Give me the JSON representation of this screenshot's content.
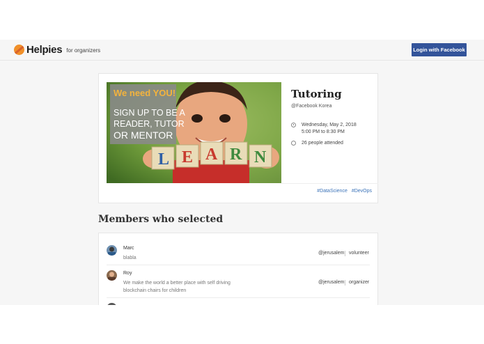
{
  "header": {
    "brand": "Helpies",
    "brand_sub": "for organizers",
    "login_label": "Login with Facebook"
  },
  "event": {
    "image_lines": [
      "We need YOU!",
      "SIGN UP TO BE A",
      "READER, TUTOR",
      "OR MENTOR"
    ],
    "blocks": [
      "L",
      "E",
      "A",
      "R",
      "N"
    ],
    "title": "Tutoring",
    "organizer": "@Facebook Korea",
    "date": "Wednesday, May 2, 2018",
    "time": "5:00 PM to 8:30 PM",
    "attended": "26 people attended",
    "tags": [
      "#DataScience",
      "#DevOps"
    ]
  },
  "members_section": {
    "title": "Members who selected",
    "members": [
      {
        "name": "Marc",
        "description": "blabla",
        "location": "@jerusalem",
        "role": "volunteer"
      },
      {
        "name": "Roy",
        "description": "We make the world a better place with self driving blockchain chairs for children",
        "location": "@jerusalem",
        "role": "organizer"
      }
    ]
  },
  "colors": {
    "accent": "#33549a",
    "link": "#3a72b8",
    "brand_orange": "#f0902a"
  }
}
